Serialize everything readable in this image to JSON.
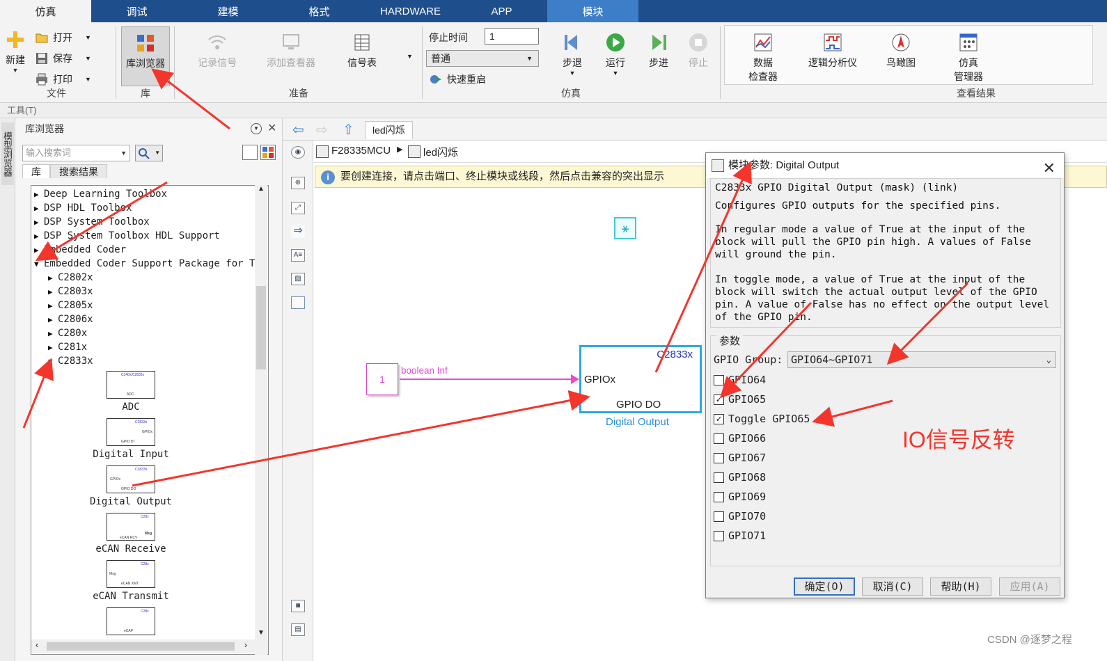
{
  "tabs": [
    "仿真",
    "调试",
    "建模",
    "格式",
    "HARDWARE",
    "APP",
    "模块"
  ],
  "ribbon": {
    "file": {
      "new": "新建",
      "open": "打开",
      "save": "保存",
      "print": "打印",
      "group": "文件"
    },
    "library": {
      "browser": "库浏览器",
      "group": "库"
    },
    "prepare": {
      "log_signals": "记录信号",
      "add_viewer": "添加查看器",
      "signal_table": "信号表",
      "group": "准备"
    },
    "simulate": {
      "stop_time_label": "停止时间",
      "stop_time_value": "1",
      "mode": "普通",
      "fast_restart": "快速重启",
      "step_back": "步退",
      "run": "运行",
      "step_forward": "步进",
      "stop": "停止",
      "group": "仿真"
    },
    "review": {
      "data_inspector_1": "数据",
      "data_inspector_2": "检查器",
      "logic_analyzer": "逻辑分析仪",
      "birds_eye": "鸟瞰图",
      "sim_manager_1": "仿真",
      "sim_manager_2": "管理器",
      "group": "查看结果"
    }
  },
  "tools_label": "工具(T)",
  "side_label": "模型浏览器",
  "library": {
    "title": "库浏览器",
    "search_placeholder": "输入搜索词",
    "tab_lib": "库",
    "tab_results": "搜索结果",
    "tree": [
      "Deep Learning Toolbox",
      "DSP HDL Toolbox",
      "DSP System Toolbox",
      "DSP System Toolbox HDL Support",
      "Embedded Coder",
      "Embedded Coder Support Package for Te.",
      "C2802x",
      "C2803x",
      "C2805x",
      "C2806x",
      "C280x",
      "C281x",
      "C2833x"
    ],
    "blocks": [
      "ADC",
      "Digital Input",
      "Digital Output",
      "eCAN Receive",
      "eCAN Transmit"
    ]
  },
  "canvas": {
    "tab": "led闪烁",
    "path_root": "F28335MCU",
    "path_model": "led闪烁",
    "info": "要创建连接，请点击端口、终止模块或线段，然后点击兼容的突出显示",
    "const_value": "1",
    "signal_label": "boolean Inf",
    "block_tag": "C2833x",
    "block_in": "GPIOx",
    "block_body": "GPIO DO",
    "block_name": "Digital Output"
  },
  "dialog": {
    "title": "模块参数: Digital Output",
    "subtitle": "C2833x GPIO Digital Output (mask) (link)",
    "desc": [
      "Configures GPIO outputs for the specified pins.",
      "",
      "In regular mode a value of True at the input of the",
      "block will pull the GPIO pin high. A values of False",
      "will ground the pin.",
      "",
      "In toggle mode, a value of True at the input of the",
      "block will switch the actual output level of the GPIO",
      "pin. A value of False has no effect on the output level",
      "of the GPIO pin."
    ],
    "params_label": "参数",
    "group_label": "GPIO Group:",
    "group_value": "GPIO64~GPIO71",
    "checks": [
      {
        "label": "GPIO64",
        "checked": false
      },
      {
        "label": "GPIO65",
        "checked": true
      },
      {
        "label": "Toggle GPIO65",
        "checked": true
      },
      {
        "label": "GPIO66",
        "checked": false
      },
      {
        "label": "GPIO67",
        "checked": false
      },
      {
        "label": "GPIO68",
        "checked": false
      },
      {
        "label": "GPIO69",
        "checked": false
      },
      {
        "label": "GPIO70",
        "checked": false
      },
      {
        "label": "GPIO71",
        "checked": false
      }
    ],
    "ok": "确定(O)",
    "cancel": "取消(C)",
    "help": "帮助(H)",
    "apply": "应用(A)"
  },
  "annotation": "IO信号反转",
  "watermark": "CSDN @逐梦之程",
  "colors": {
    "tab_bar": "#1f4e8c",
    "arrow": "#f4352c",
    "block_border": "#2aa7e8",
    "signal": "#e94bd6",
    "block_tag": "#1f2fc8"
  }
}
